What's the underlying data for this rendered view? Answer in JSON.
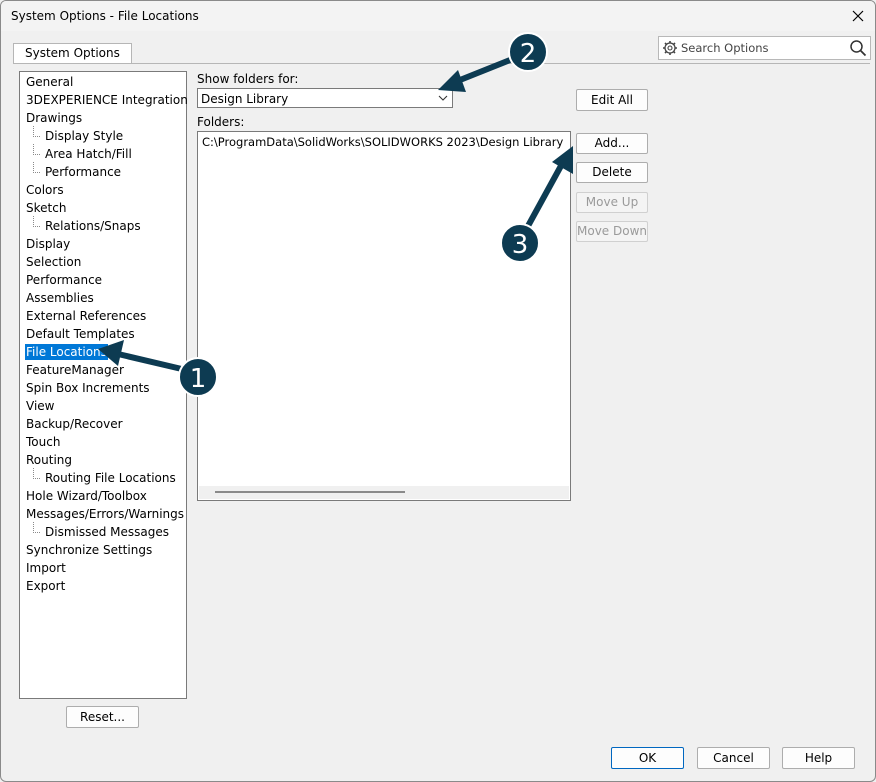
{
  "window": {
    "title": "System Options - File Locations"
  },
  "tab": {
    "label": "System Options"
  },
  "search": {
    "placeholder": "Search Options"
  },
  "tree": {
    "items": [
      {
        "label": "General"
      },
      {
        "label": "3DEXPERIENCE Integration"
      },
      {
        "label": "Drawings"
      },
      {
        "label": "Display Style"
      },
      {
        "label": "Area Hatch/Fill"
      },
      {
        "label": "Performance"
      },
      {
        "label": "Colors"
      },
      {
        "label": "Sketch"
      },
      {
        "label": "Relations/Snaps"
      },
      {
        "label": "Display"
      },
      {
        "label": "Selection"
      },
      {
        "label": "Performance"
      },
      {
        "label": "Assemblies"
      },
      {
        "label": "External References"
      },
      {
        "label": "Default Templates"
      },
      {
        "label": "File Locations"
      },
      {
        "label": "FeatureManager"
      },
      {
        "label": "Spin Box Increments"
      },
      {
        "label": "View"
      },
      {
        "label": "Backup/Recover"
      },
      {
        "label": "Touch"
      },
      {
        "label": "Routing"
      },
      {
        "label": "Routing File Locations"
      },
      {
        "label": "Hole Wizard/Toolbox"
      },
      {
        "label": "Messages/Errors/Warnings"
      },
      {
        "label": "Dismissed Messages"
      },
      {
        "label": "Synchronize Settings"
      },
      {
        "label": "Import"
      },
      {
        "label": "Export"
      }
    ]
  },
  "main": {
    "show_folders_label": "Show folders for:",
    "show_folders_value": "Design Library",
    "folders_label": "Folders:",
    "folders": [
      "C:\\ProgramData\\SolidWorks\\SOLIDWORKS 2023\\Design Library"
    ],
    "buttons": {
      "edit_all": "Edit All",
      "add": "Add...",
      "delete": "Delete",
      "move_up": "Move Up",
      "move_down": "Move Down"
    }
  },
  "footer": {
    "reset": "Reset...",
    "ok": "OK",
    "cancel": "Cancel",
    "help": "Help"
  },
  "annotations": {
    "badge1": "1",
    "badge2": "2",
    "badge3": "3",
    "color": "#0d3b52"
  }
}
